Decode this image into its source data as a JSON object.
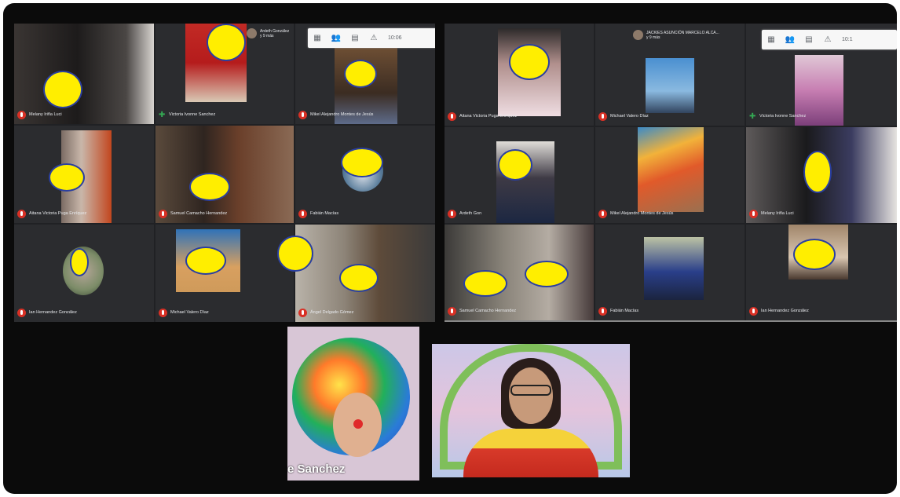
{
  "left_panel": {
    "owner_name": "Ardeth González",
    "owner_more": "y 9 más",
    "time": "10:06",
    "tiles": [
      {
        "name": "Melany Iriña Luci"
      },
      {
        "name": "Victoria Ivonne Sanchez"
      },
      {
        "name": "Mikel Alejandro Montes de Jesús"
      },
      {
        "name": "Aitana Victoria Puga Enríquez"
      },
      {
        "name": "Samuel Camacho Hernandez"
      },
      {
        "name": "Fabián Macías"
      },
      {
        "name": "Ian Hernandez González"
      },
      {
        "name": "Michael Valero Díaz"
      },
      {
        "name": "Ángel Delgado Gómez"
      }
    ]
  },
  "right_panel": {
    "owner_name": "JACKIES ASUNCIÓN MARCELO ALCA...",
    "owner_more": "y 9 más",
    "time": "10:1",
    "tiles": [
      {
        "name": "Aitana Victoria Puga Enríquez"
      },
      {
        "name": "Michael Valero Díaz"
      },
      {
        "name": "Victoria Ivonne Sanchez"
      },
      {
        "name": "Ardeth Gon"
      },
      {
        "name": "Mikel Alejandro Montes de Jesús"
      },
      {
        "name": "Melany Iriña Luci"
      },
      {
        "name": "Samuel Camacho Hernandez"
      },
      {
        "name": "Fabián Macías"
      },
      {
        "name": "Ian Hernandez González"
      }
    ]
  },
  "presenters": {
    "clown_caption": "e Sanchez"
  },
  "toolbar_icons": [
    "layout-icon",
    "people-icon",
    "chat-icon",
    "activities-icon"
  ]
}
